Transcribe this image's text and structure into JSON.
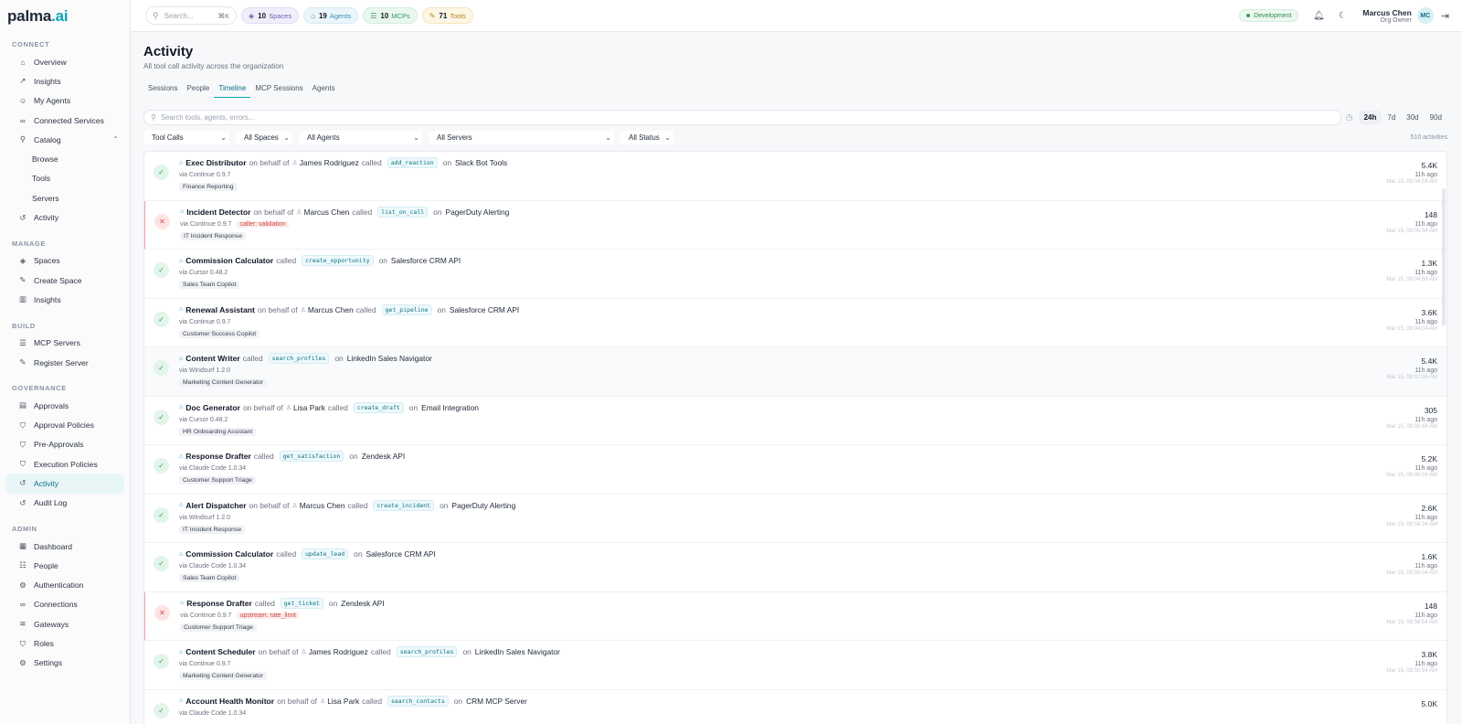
{
  "brand": {
    "name": "palma",
    "suffix": ".ai"
  },
  "sidebar": {
    "sections": [
      {
        "title": "CONNECT",
        "items": [
          {
            "label": "Overview",
            "icon": "home-icon"
          },
          {
            "label": "Insights",
            "icon": "trend-icon"
          },
          {
            "label": "My Agents",
            "icon": "bot-icon"
          },
          {
            "label": "Connected Services",
            "icon": "link-icon"
          },
          {
            "label": "Catalog",
            "icon": "search-icon"
          },
          {
            "label": "Browse",
            "icon": ""
          },
          {
            "label": "Tools",
            "icon": ""
          },
          {
            "label": "Servers",
            "icon": ""
          },
          {
            "label": "Activity",
            "icon": "history-icon"
          }
        ]
      },
      {
        "title": "MANAGE",
        "items": [
          {
            "label": "Spaces",
            "icon": "layers-icon"
          },
          {
            "label": "Create Space",
            "icon": "wrench-icon"
          },
          {
            "label": "Insights",
            "icon": "bar-chart-icon"
          }
        ]
      },
      {
        "title": "BUILD",
        "items": [
          {
            "label": "MCP Servers",
            "icon": "server-icon"
          },
          {
            "label": "Register Server",
            "icon": "wrench-icon"
          }
        ]
      },
      {
        "title": "GOVERNANCE",
        "items": [
          {
            "label": "Approvals",
            "icon": "doc-icon"
          },
          {
            "label": "Approval Policies",
            "icon": "shield-icon"
          },
          {
            "label": "Pre-Approvals",
            "icon": "shield-check-icon"
          },
          {
            "label": "Execution Policies",
            "icon": "shield-icon"
          },
          {
            "label": "Activity",
            "icon": "history-icon"
          },
          {
            "label": "Audit Log",
            "icon": "history-icon"
          }
        ]
      },
      {
        "title": "ADMIN",
        "items": [
          {
            "label": "Dashboard",
            "icon": "grid-icon"
          },
          {
            "label": "People",
            "icon": "people-icon"
          },
          {
            "label": "Authentication",
            "icon": "gear-icon"
          },
          {
            "label": "Connections",
            "icon": "link-icon"
          },
          {
            "label": "Gateways",
            "icon": "wifi-icon"
          },
          {
            "label": "Roles",
            "icon": "shield-icon"
          },
          {
            "label": "Settings",
            "icon": "gear-icon"
          }
        ]
      }
    ]
  },
  "topbar": {
    "search_placeholder": "Search...",
    "shortcut": "⌘K",
    "stats": [
      {
        "count": "10",
        "label": "Spaces"
      },
      {
        "count": "19",
        "label": "Agents"
      },
      {
        "count": "10",
        "label": "MCPs"
      },
      {
        "count": "71",
        "label": "Tools"
      }
    ],
    "env": "Development",
    "user_name": "Marcus Chen",
    "user_role": "Org Owner",
    "initials": "MC"
  },
  "page": {
    "title": "Activity",
    "subtitle": "All tool call activity across the organization",
    "tabs": [
      "Sessions",
      "People",
      "Timeline",
      "MCP Sessions",
      "Agents"
    ],
    "search_placeholder": "Search tools, agents, errors...",
    "ranges": [
      "24h",
      "7d",
      "30d",
      "90d"
    ],
    "filters": [
      "Tool Calls",
      "All Spaces",
      "All Agents",
      "All Servers",
      "All Status"
    ],
    "count": "510 activities"
  },
  "rows": [
    {
      "status": "ok",
      "agent": "Exec Distributor",
      "behalf": "James Rodriguez",
      "tool": "add_reaction",
      "server": "Slack Bot Tools",
      "via": "via Continue 0.9.7",
      "error": "",
      "space": "Finance Reporting",
      "num": "5.4K",
      "ago": "11h ago",
      "ts": "Mar 15, 08:04:58 AM"
    },
    {
      "status": "bad",
      "agent": "Incident Detector",
      "behalf": "Marcus Chen",
      "tool": "list_on_call",
      "server": "PagerDuty Alerting",
      "via": "via Continue 0.9.7",
      "error": "caller: validation",
      "space": "IT Incident Response",
      "num": "148",
      "ago": "11h ago",
      "ts": "Mar 15, 08:00:54 AM"
    },
    {
      "status": "ok",
      "agent": "Commission Calculator",
      "behalf": "",
      "tool": "create_opportunity",
      "server": "Salesforce CRM API",
      "via": "via Cursor 0.48.2",
      "error": "",
      "space": "Sales Team Copilot",
      "num": "1.3K",
      "ago": "11h ago",
      "ts": "Mar 15, 08:04:58 AM"
    },
    {
      "status": "ok",
      "agent": "Renewal Assistant",
      "behalf": "Marcus Chen",
      "tool": "get_pipeline",
      "server": "Salesforce CRM API",
      "via": "via Continue 0.9.7",
      "error": "",
      "space": "Customer Success Copilot",
      "num": "3.6K",
      "ago": "11h ago",
      "ts": "Mar 15, 08:04:04 AM"
    },
    {
      "status": "ok",
      "agent": "Content Writer",
      "behalf": "",
      "tool": "search_profiles",
      "server": "LinkedIn Sales Navigator",
      "via": "via Windsurf 1.2.0",
      "error": "",
      "space": "Marketing Content Generator",
      "num": "5.4K",
      "ago": "11h ago",
      "ts": "Mar 15, 08:02:06 AM"
    },
    {
      "status": "ok",
      "agent": "Doc Generator",
      "behalf": "Lisa Park",
      "tool": "create_draft",
      "server": "Email Integration",
      "via": "via Cursor 0.48.2",
      "error": "",
      "space": "HR Onboarding Assistant",
      "num": "305",
      "ago": "11h ago",
      "ts": "Mar 15, 08:00:44 AM"
    },
    {
      "status": "ok",
      "agent": "Response Drafter",
      "behalf": "",
      "tool": "get_satisfaction",
      "server": "Zendesk API",
      "via": "via Claude Code 1.0.34",
      "error": "",
      "space": "Customer Support Triage",
      "num": "5.2K",
      "ago": "11h ago",
      "ts": "Mar 15, 08:00:04 AM"
    },
    {
      "status": "ok",
      "agent": "Alert Dispatcher",
      "behalf": "Marcus Chen",
      "tool": "create_incident",
      "server": "PagerDuty Alerting",
      "via": "via Windsurf 1.2.0",
      "error": "",
      "space": "IT Incident Response",
      "num": "2.6K",
      "ago": "11h ago",
      "ts": "Mar 15, 08:58:34 AM"
    },
    {
      "status": "ok",
      "agent": "Commission Calculator",
      "behalf": "",
      "tool": "update_lead",
      "server": "Salesforce CRM API",
      "via": "via Claude Code 1.0.34",
      "error": "",
      "space": "Sales Team Copilot",
      "num": "1.6K",
      "ago": "11h ago",
      "ts": "Mar 15, 08:58:04 AM"
    },
    {
      "status": "bad",
      "agent": "Response Drafter",
      "behalf": "",
      "tool": "get_ticket",
      "server": "Zendesk API",
      "via": "via Continue 0.9.7",
      "error": "upstream: rate_limit",
      "space": "Customer Support Triage",
      "num": "148",
      "ago": "11h ago",
      "ts": "Mar 15, 08:58:54 AM"
    },
    {
      "status": "ok",
      "agent": "Content Scheduler",
      "behalf": "James Rodriguez",
      "tool": "search_profiles",
      "server": "LinkedIn Sales Navigator",
      "via": "via Continue 0.9.7",
      "error": "",
      "space": "Marketing Content Generator",
      "num": "3.8K",
      "ago": "11h ago",
      "ts": "Mar 15, 08:50:54 AM"
    },
    {
      "status": "ok",
      "agent": "Account Health Monitor",
      "behalf": "Lisa Park",
      "tool": "search_contacts",
      "server": "CRM MCP Server",
      "via": "via Claude Code 1.0.34",
      "error": "",
      "space": "",
      "num": "5.0K",
      "ago": "",
      "ts": ""
    }
  ],
  "text": {
    "on_behalf_of": "on behalf of",
    "called": "called",
    "on": "on"
  },
  "colors": {
    "accent": "#0ea5b7",
    "success": "#2f9e5b",
    "error": "#d94848"
  }
}
